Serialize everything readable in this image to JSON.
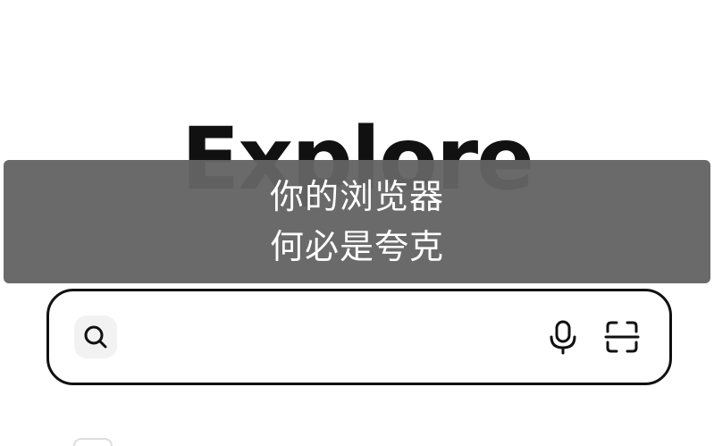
{
  "brand": {
    "title": "Explore"
  },
  "subtitle": {
    "line1": "你的浏览器",
    "line2": "何必是夸克"
  },
  "search": {
    "placeholder": "",
    "value": ""
  },
  "icons": {
    "search": "search-icon",
    "microphone": "microphone-icon",
    "scan": "scan-icon"
  },
  "colors": {
    "overlay": "#646464",
    "text": "#111111",
    "background": "#ffffff"
  }
}
